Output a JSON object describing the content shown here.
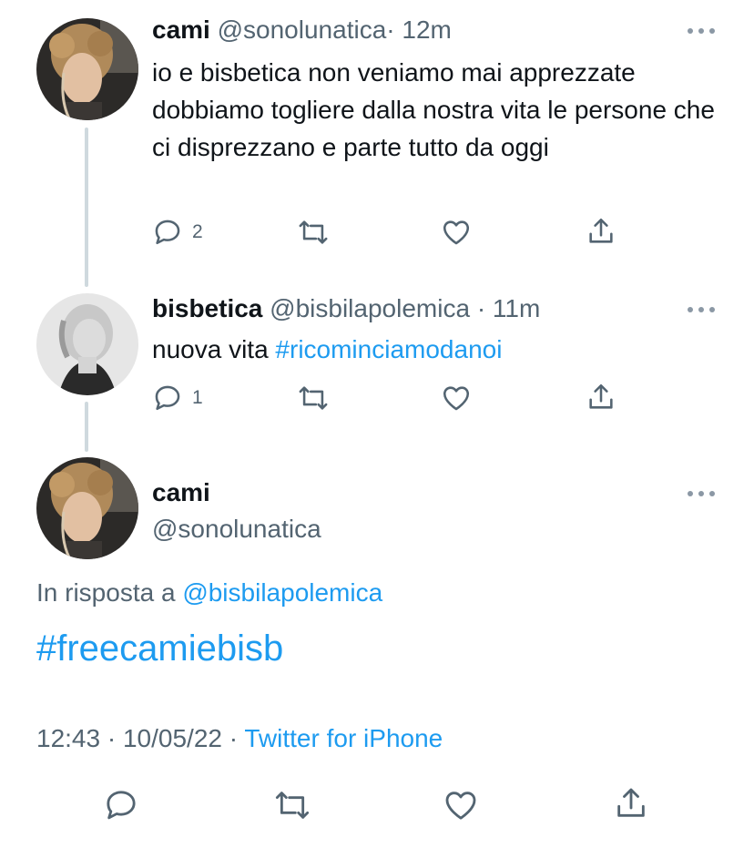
{
  "tweets": [
    {
      "name": "cami",
      "handle": "@sonolunatica",
      "dot": "·",
      "time": "12m",
      "text": "io e bisbetica non veniamo mai apprezzate dobbiamo togliere dalla nostra vita le persone che ci disprezzano e parte tutto da oggi",
      "reply_count": "2"
    },
    {
      "name": "bisbetica",
      "handle": "@bisbilapolemica",
      "dot": "·",
      "time": "11m",
      "text_plain": "nuova vita ",
      "hashtag": "#ricominciamodanoi",
      "reply_count": "1"
    }
  ],
  "main": {
    "name": "cami",
    "handle": "@sonolunatica",
    "reply_prefix": "In risposta a",
    "reply_to": "@bisbilapolemica",
    "hashtag": "#freecamiebisb",
    "time": "12:43",
    "sep1": "·",
    "date": "10/05/22",
    "sep2": "·",
    "source": "Twitter for iPhone"
  },
  "icons": {
    "more": "more-horizontal-icon",
    "reply": "reply-bubble-icon",
    "retweet": "retweet-icon",
    "like": "heart-icon",
    "share": "share-upload-icon"
  },
  "colors": {
    "link": "#1d9bf0",
    "muted": "#536471",
    "icon": "#536471",
    "thread_line": "#cfd9de"
  }
}
